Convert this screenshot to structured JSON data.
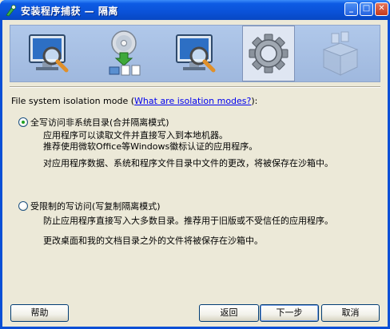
{
  "window": {
    "title": "安装程序捕获 — 隔离",
    "minimize_glyph": "_",
    "maximize_glyph": "□",
    "close_glyph": "✕"
  },
  "steps": [
    {
      "icon": "monitor-magnifier-icon",
      "state": "done"
    },
    {
      "icon": "disc-install-icon",
      "state": "done"
    },
    {
      "icon": "monitor-magnifier-icon",
      "state": "done"
    },
    {
      "icon": "gear-icon",
      "state": "active"
    },
    {
      "icon": "package-box-icon",
      "state": "pending"
    }
  ],
  "isolation": {
    "prefix": "File system isolation mode (",
    "link": "What are isolation modes?",
    "suffix": "):"
  },
  "options": [
    {
      "label": "全写访问非系统目录(合并隔离模式)",
      "selected": true,
      "desc1": "应用程序可以读取文件并直接写入到本地机器。",
      "desc2": "推荐使用微软Office等Windows徽标认证的应用程序。",
      "desc3": "对应用程序数据、系统和程序文件目录中文件的更改，将被保存在沙箱中。"
    },
    {
      "label": "受限制的写访问(写复制隔离模式)",
      "selected": false,
      "desc1": "防止应用程序直接写入大多数目录。推荐用于旧版或不受信任的应用程序。",
      "desc2": "更改桌面和我的文档目录之外的文件将被保存在沙箱中。"
    }
  ],
  "buttons": {
    "help": "帮助",
    "back": "返回",
    "next": "下一步",
    "cancel": "取消"
  }
}
